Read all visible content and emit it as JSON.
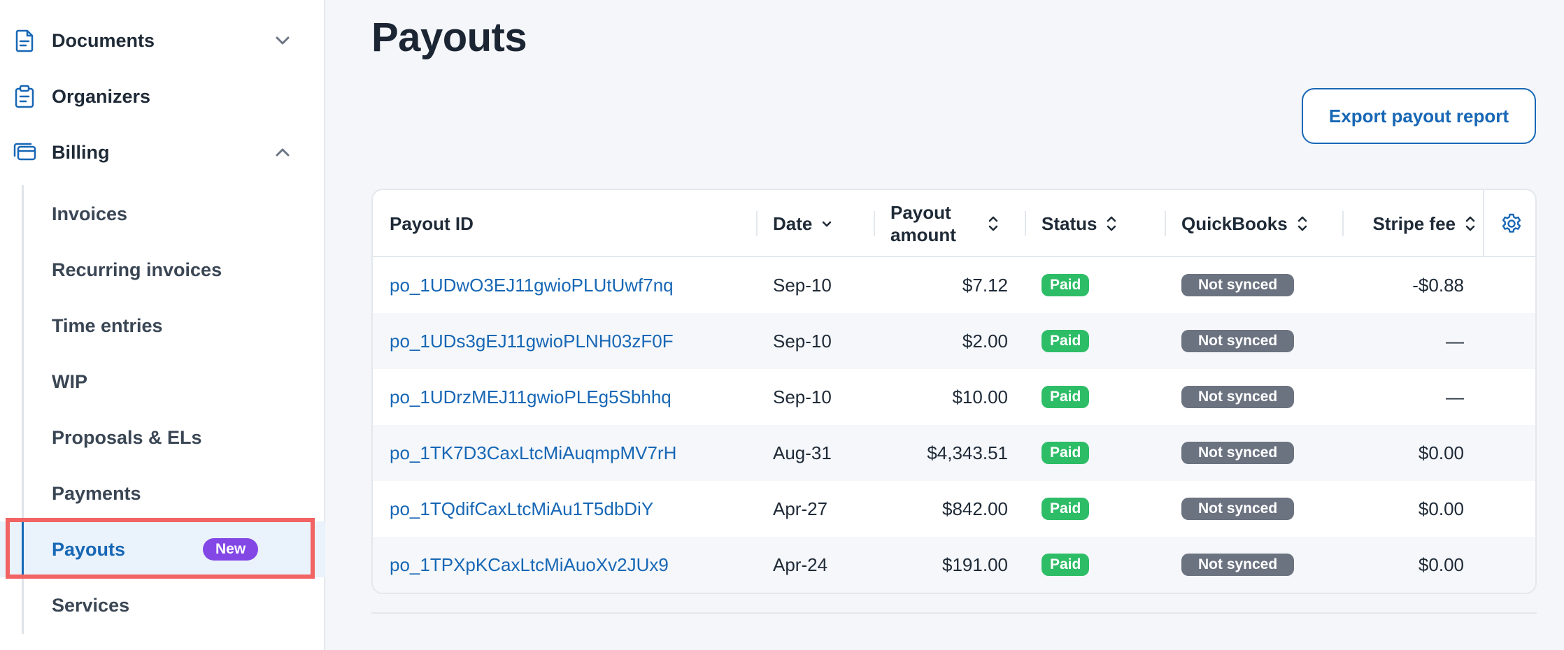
{
  "sidebar": {
    "top_items": [
      {
        "label": "Documents",
        "icon": "document-icon",
        "chevron": "chevron-down-icon"
      },
      {
        "label": "Organizers",
        "icon": "clipboard-icon"
      },
      {
        "label": "Billing",
        "icon": "billing-icon",
        "chevron": "chevron-up-icon"
      }
    ],
    "billing_items": [
      {
        "label": "Invoices"
      },
      {
        "label": "Recurring invoices"
      },
      {
        "label": "Time entries"
      },
      {
        "label": "WIP"
      },
      {
        "label": "Proposals & ELs"
      },
      {
        "label": "Payments"
      },
      {
        "label": "Payouts",
        "badge": "New",
        "active": true
      },
      {
        "label": "Services"
      }
    ]
  },
  "main": {
    "title": "Payouts",
    "export_label": "Export payout report"
  },
  "table": {
    "headers": {
      "payout_id": "Payout ID",
      "date": "Date",
      "amount_line1": "Payout",
      "amount_line2": "amount",
      "status": "Status",
      "quickbooks": "QuickBooks",
      "stripe_fee": "Stripe fee"
    },
    "rows": [
      {
        "id": "po_1UDwO3EJ11gwioPLUtUwf7nq",
        "date": "Sep-10",
        "amount": "$7.12",
        "status": "Paid",
        "quickbooks": "Not synced",
        "fee": "-$0.88"
      },
      {
        "id": "po_1UDs3gEJ11gwioPLNH03zF0F",
        "date": "Sep-10",
        "amount": "$2.00",
        "status": "Paid",
        "quickbooks": "Not synced",
        "fee": "—"
      },
      {
        "id": "po_1UDrzMEJ11gwioPLEg5Sbhhq",
        "date": "Sep-10",
        "amount": "$10.00",
        "status": "Paid",
        "quickbooks": "Not synced",
        "fee": "—"
      },
      {
        "id": "po_1TK7D3CaxLtcMiAuqmpMV7rH",
        "date": "Aug-31",
        "amount": "$4,343.51",
        "status": "Paid",
        "quickbooks": "Not synced",
        "fee": "$0.00"
      },
      {
        "id": "po_1TQdifCaxLtcMiAu1T5dbDiY",
        "date": "Apr-27",
        "amount": "$842.00",
        "status": "Paid",
        "quickbooks": "Not synced",
        "fee": "$0.00"
      },
      {
        "id": "po_1TPXpKCaxLtcMiAuoXv2JUx9",
        "date": "Apr-24",
        "amount": "$191.00",
        "status": "Paid",
        "quickbooks": "Not synced",
        "fee": "$0.00"
      }
    ]
  },
  "colors": {
    "accent": "#1767b5",
    "paid": "#2ebd67",
    "not_synced": "#6b7280",
    "new_badge": "#8247e5",
    "highlight": "#f26363"
  }
}
